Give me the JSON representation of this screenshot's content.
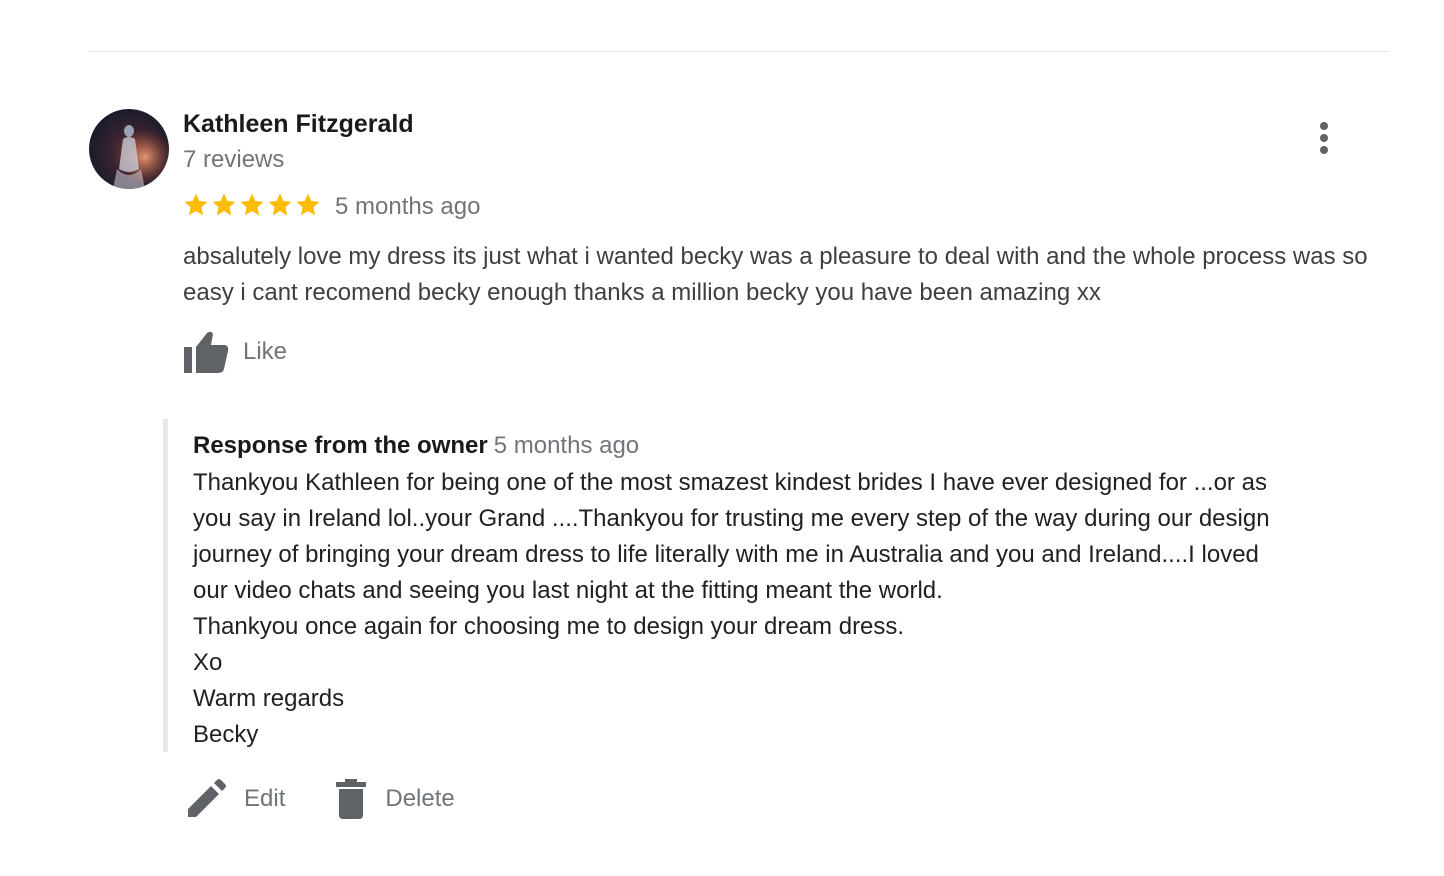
{
  "review": {
    "reviewer_name": "Kathleen Fitzgerald",
    "review_count": "7 reviews",
    "rating": 5,
    "max_rating": 5,
    "date": "5 months ago",
    "text": "absalutely love my dress its just what i wanted becky was a pleasure to deal with and the whole process was so easy i cant recomend becky enough thanks a million becky you have been amazing xx",
    "like_label": "Like"
  },
  "owner_response": {
    "title": "Response from the owner",
    "date": "5 months ago",
    "lines": [
      "Thankyou Kathleen for being one of the most smazest kindest brides I have ever designed for ...or as",
      "you say in Ireland lol..your Grand ....Thankyou for trusting me every step of the way during our design",
      "journey of bringing your dream dress to life literally with me in Australia and you and Ireland....I loved",
      "our video chats and seeing you last night at the fitting meant the world.",
      "Thankyou once again for choosing me to design your dream dress.",
      "Xo",
      "Warm regards",
      "Becky"
    ]
  },
  "actions": {
    "edit_label": "Edit",
    "delete_label": "Delete"
  },
  "icons": {
    "more": "more-vert-icon",
    "star": "star-icon",
    "like": "thumbs-up-icon",
    "edit": "pencil-icon",
    "delete": "trash-icon"
  },
  "colors": {
    "star": "#fbbc04",
    "secondary_text": "#70757a",
    "icon": "#5f6368",
    "response_border": "#e8e8e8"
  }
}
